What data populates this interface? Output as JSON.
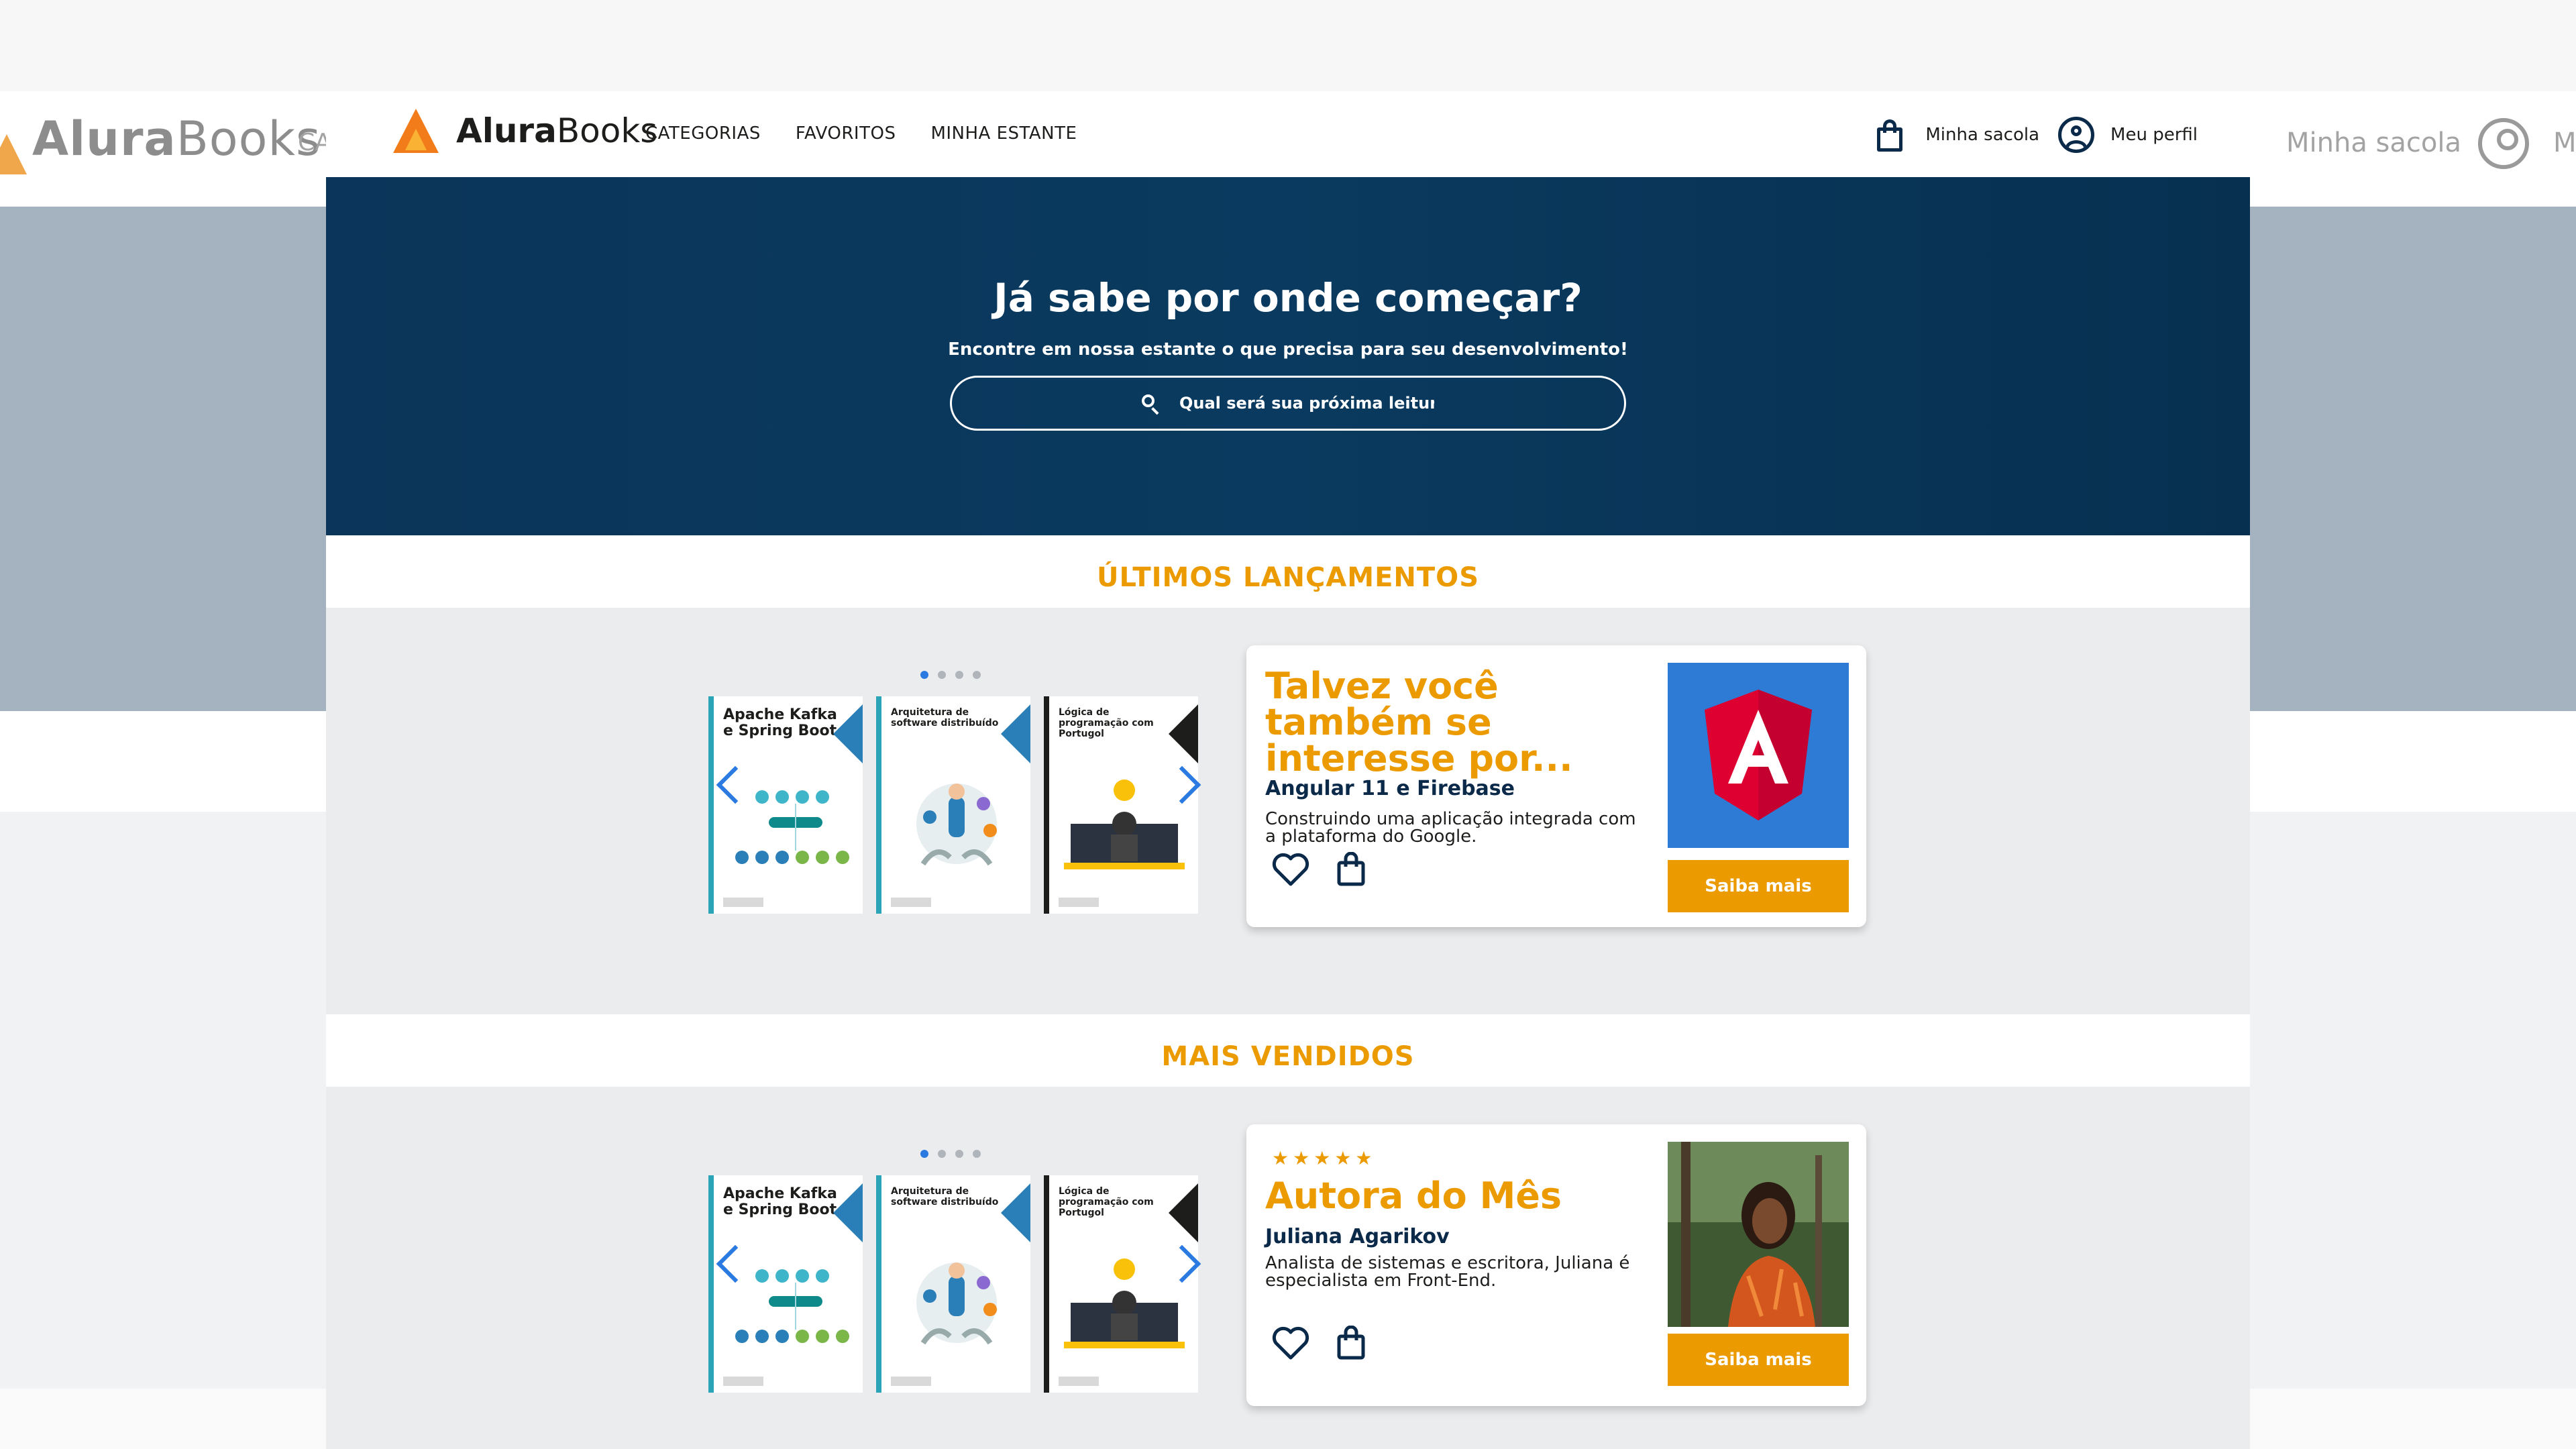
{
  "background": {
    "logo_prefix": "Alura",
    "logo_suffix": "Books",
    "nav_fragment": "CA",
    "bag_label": "Minha sacola",
    "profile_fragment": "M"
  },
  "header": {
    "logo_prefix": "Alura",
    "logo_suffix": "Books",
    "nav": [
      "CATEGORIAS",
      "FAVORITOS",
      "MINHA ESTANTE"
    ],
    "bag_label": "Minha sacola",
    "profile_label": "Meu perfil"
  },
  "hero": {
    "title": "Já sabe por onde começar?",
    "subtitle": "Encontre em nossa estante o que precisa para seu desenvolvimento!",
    "search_placeholder": "Qual será sua próxima leitura?"
  },
  "sections": [
    {
      "title": "ÚLTIMOS LANÇAMENTOS",
      "books": [
        {
          "title": "Apache Kafka e Spring Boot"
        },
        {
          "title": "Arquitetura de software distribuído"
        },
        {
          "title": "Lógica de programação com Portugol"
        }
      ],
      "card": {
        "heading": "Talvez você também se interesse por...",
        "book_title": "Angular 11 e Firebase",
        "description": "Construindo uma aplicação integrada com a plataforma do Google.",
        "button": "Saiba mais"
      }
    },
    {
      "title": "MAIS VENDIDOS",
      "books": [
        {
          "title": "Apache Kafka e Spring Boot"
        },
        {
          "title": "Arquitetura de software distribuído"
        },
        {
          "title": "Lógica de programação com Portugol"
        }
      ],
      "card": {
        "stars": "★★★★★",
        "heading": "Autora do Mês",
        "book_title": "Juliana Agarikov",
        "description": "Analista de sistemas e escritora, Juliana é especialista em Front-End.",
        "button": "Saiba mais",
        "rating": 5
      }
    }
  ],
  "colors": {
    "brand_navy": "#0b355a",
    "accent_orange": "#eb9b00",
    "carousel_blue": "#2a7ae2"
  }
}
